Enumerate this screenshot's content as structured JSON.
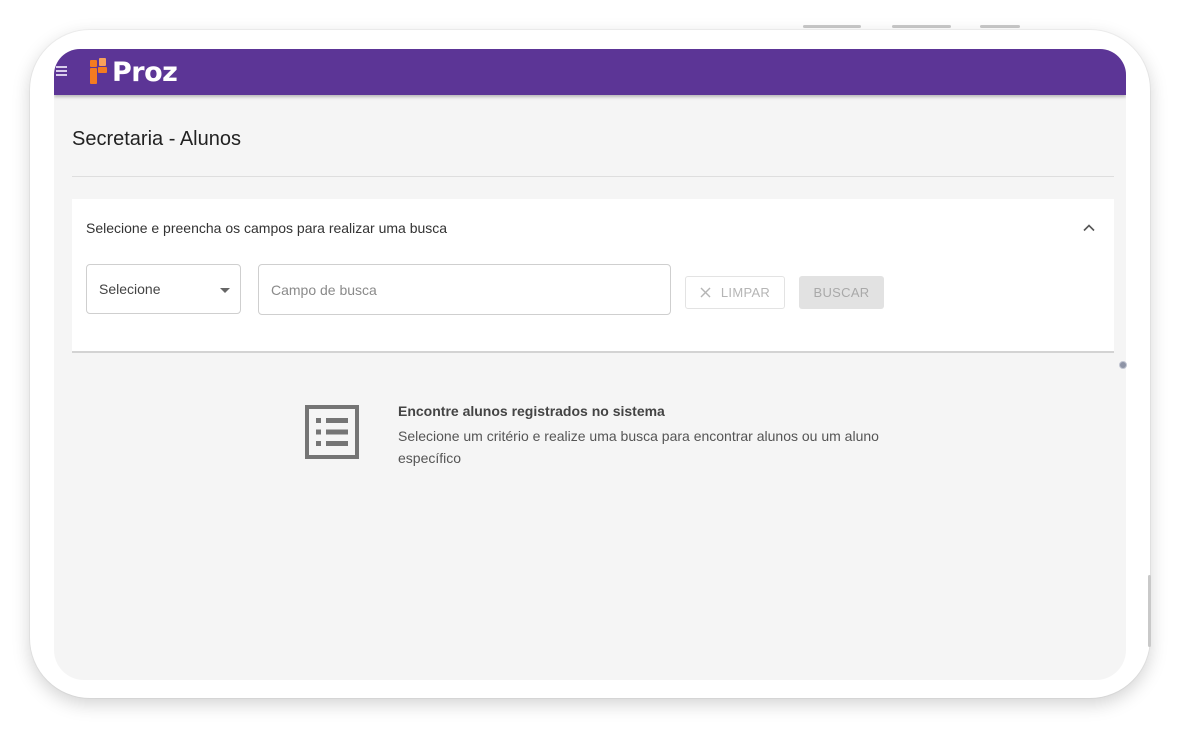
{
  "app": {
    "brand": "Proz",
    "brand_colors": {
      "topbar": "#5c3596",
      "logo_orange": "#f47b20"
    }
  },
  "page": {
    "title": "Secretaria - Alunos"
  },
  "search_panel": {
    "heading": "Selecione e preencha os campos para realizar uma busca",
    "criteria_select": {
      "selected": "Selecione"
    },
    "search_field": {
      "placeholder": "Campo de busca",
      "value": ""
    },
    "clear_button": "LIMPAR",
    "search_button": "BUSCAR",
    "collapse_icon": "chevron-up-icon"
  },
  "empty_state": {
    "icon": "list-icon",
    "title": "Encontre alunos registrados no sistema",
    "description": "Selecione um critério e realize uma busca para encontrar alunos ou um aluno específico"
  }
}
